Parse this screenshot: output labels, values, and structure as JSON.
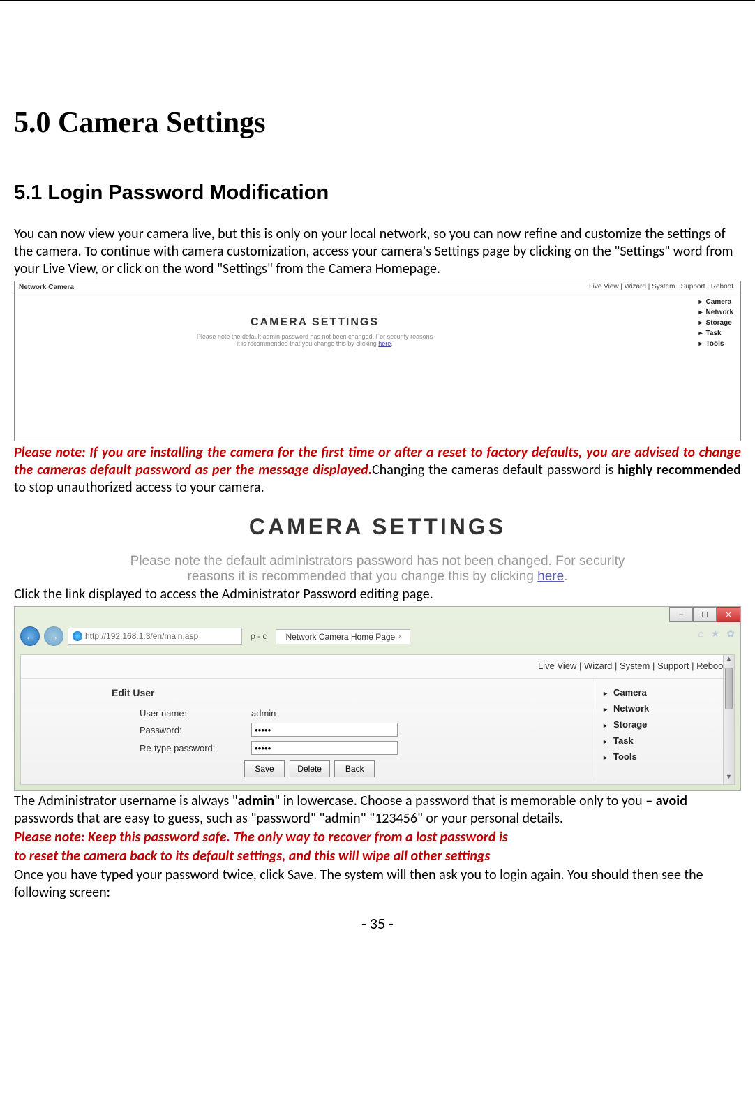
{
  "h1": "5.0 Camera Settings",
  "h2": "5.1 Login Password Modification",
  "para1": "You can now view your camera live, but this is only on your local network, so you can now refine and customize the settings of the camera. To continue with camera customization, access your camera's Settings page by clicking on the \"Settings\" word from your Live View, or click on the word \"Settings\" from the Camera Homepage.",
  "ss1": {
    "title": "Network Camera",
    "topnav": "Live View  |  Wizard  |  System  |  Support  |  Reboot",
    "sidebar": [
      "Camera",
      "Network",
      "Storage",
      "Task",
      "Tools"
    ],
    "mainTitle": "CAMERA SETTINGS",
    "note_pre": "Please note the default admin password has not been changed. For security reasons",
    "note_post": "it is recommended that you change this by clicking ",
    "here": "here"
  },
  "note1_red": "Please note: If you are installing the camera for the first time or after a reset to factory defaults, you are advised to change the cameras default password as per the message displayed.",
  "note1_b": "Changing the cameras default password is ",
  "note1_strong": "highly recommended",
  "note1_c": " to stop unauthorized access to your camera.",
  "ss2": {
    "title": "CAMERA SETTINGS",
    "line1": "Please note the default administrators password has not been changed. For security",
    "line2": "reasons it is recommended that you change this by clicking ",
    "here": "here",
    "dot": "."
  },
  "para2": "Click the link displayed to access the Administrator Password editing page.",
  "ss3": {
    "url": "http://192.168.1.3/en/main.asp",
    "urlsuffix": "ρ - c",
    "tab": "Network Camera Home Page",
    "tabclose": "×",
    "topnav": "Live View  |  Wizard  |  System  |  Support  |  Reboot",
    "editUser": "Edit User",
    "labels": {
      "user": "User name:",
      "pass": "Password:",
      "repass": "Re-type password:"
    },
    "username": "admin",
    "password": "•••••",
    "repassword": "•••••",
    "btns": {
      "save": "Save",
      "delete": "Delete",
      "back": "Back"
    },
    "sidebar": [
      "Camera",
      "Network",
      "Storage",
      "Task",
      "Tools"
    ],
    "winbtns": {
      "min": "–",
      "max": "☐",
      "close": "✕"
    }
  },
  "para3a": "The Administrator username is always \"",
  "para3_admin": "admin",
  "para3b": "\" in lowercase. Choose a password that is memorable only to you – ",
  "para3_avoid": "avoid",
  "para3c": " passwords that are easy to guess, such as \"password\" \"admin\" \"123456\" or your personal details.",
  "note2_l1": "Please note: Keep this password safe. The only way to recover from a lost password is",
  "note2_l2": "to reset the camera back to its default settings, and this will wipe all other settings",
  "para4": "Once you have typed your password twice, click Save. The system will then ask you to login again. You should then see the following screen:",
  "pagenum": "- 35 -"
}
